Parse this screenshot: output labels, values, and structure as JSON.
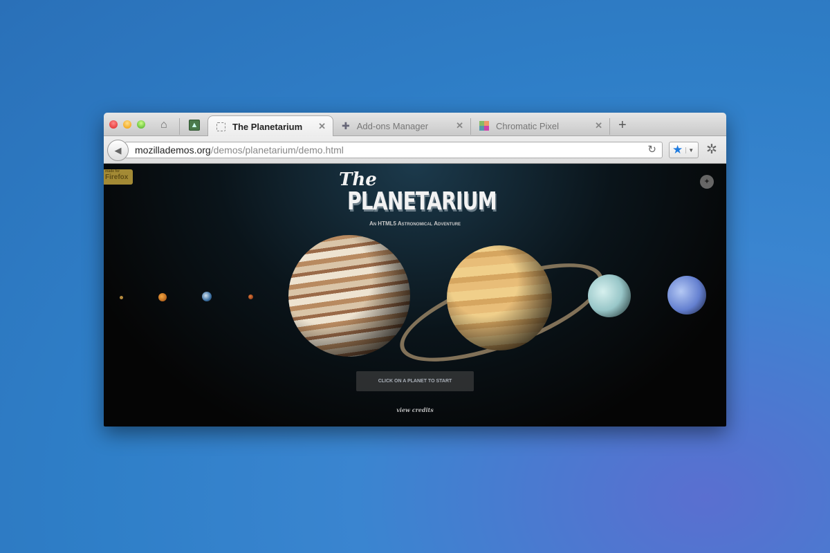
{
  "browser": {
    "tabs": [
      {
        "label": "The Planetarium",
        "icon": "dotted-page-icon",
        "active": true
      },
      {
        "label": "Add-ons Manager",
        "icon": "puzzle-icon"
      },
      {
        "label": "Chromatic Pixel",
        "icon": "color-grid-icon"
      }
    ],
    "url_domain": "mozillademos.org",
    "url_path": "/demos/planetarium/demo.html"
  },
  "page": {
    "title_script": "The",
    "title_main": "Planetarium",
    "subtitle": "An HTML5 Astronomical Adventure",
    "badge_small": "made for",
    "badge": "Firefox",
    "start_label": "CLICK ON A PLANET TO START",
    "credits": "view credits",
    "planets": [
      "Mercury",
      "Venus",
      "Earth",
      "Mars",
      "Jupiter",
      "Saturn",
      "Uranus",
      "Neptune"
    ]
  }
}
